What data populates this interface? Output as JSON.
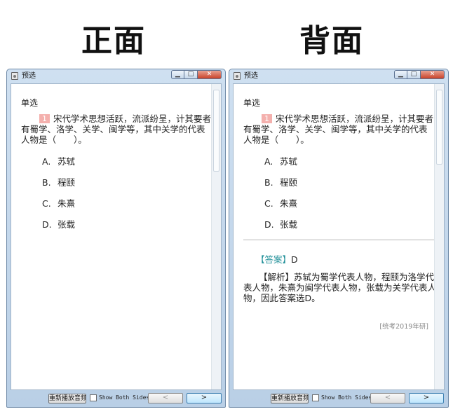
{
  "headings": {
    "front": "正面",
    "back": "背面"
  },
  "window": {
    "title": "预选",
    "controls": {
      "minimize": "▁",
      "maximize": "□",
      "close": "✕"
    }
  },
  "question": {
    "type": "单选",
    "number": "1",
    "stem": "宋代学术思想活跃，流派纷呈，计其要者有蜀学、洛学、关学、闽学等，其中关学的代表人物是（　　）。",
    "options": [
      {
        "letter": "A.",
        "text": "苏轼"
      },
      {
        "letter": "B.",
        "text": "程颐"
      },
      {
        "letter": "C.",
        "text": "朱熹"
      },
      {
        "letter": "D.",
        "text": "张载"
      }
    ]
  },
  "answer": {
    "tag": "【答案】",
    "value": "D",
    "analysis_tag": "【解析】",
    "analysis": "苏轼为蜀学代表人物，程颐为洛学代表人物，朱熹为闽学代表人物，张载为关学代表人物，因此答案选D。",
    "source": "[统考2019年研]"
  },
  "footer": {
    "replay_label": "重新播放音频",
    "show_both_label": "Show Both Sides",
    "show_both_checked": false,
    "prev_label": "<",
    "next_label": ">"
  }
}
